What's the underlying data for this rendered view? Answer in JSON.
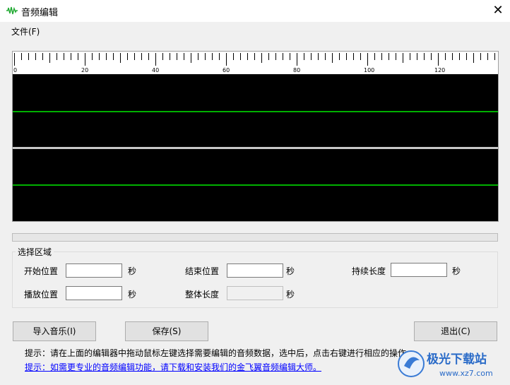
{
  "window": {
    "title": "音频编辑",
    "close_glyph": "✕"
  },
  "menu": {
    "file": "文件(F)"
  },
  "ruler": {
    "labels": [
      "0",
      "20",
      "40",
      "60",
      "80",
      "100",
      "120"
    ]
  },
  "colors": {
    "waveform_bg": "#000000",
    "channel_line": "#00b000",
    "separator": "#c8c8c8",
    "link": "#0000ff"
  },
  "selection": {
    "title": "选择区域",
    "start_label": "开始位置",
    "start_value": "",
    "start_unit": "秒",
    "end_label": "结束位置",
    "end_value": "",
    "end_unit": "秒",
    "duration_label": "持续长度",
    "duration_value": "",
    "duration_unit": "秒",
    "play_label": "播放位置",
    "play_value": "",
    "play_unit": "秒",
    "total_label": "整体长度",
    "total_value": "",
    "total_unit": "秒"
  },
  "buttons": {
    "import": "导入音乐(I)",
    "save": "保存(S)",
    "exit": "退出(C)"
  },
  "hint": "提示：请在上面的编辑器中拖动鼠标左键选择需要编辑的音频数据，选中后，点击右键进行相应的操作。",
  "link_text": "提示：如需更专业的音频编辑功能，请下载和安装我们的金飞翼音频编辑大师。",
  "watermark": {
    "brand": "极光下载站",
    "url": "www.xz7.com"
  }
}
